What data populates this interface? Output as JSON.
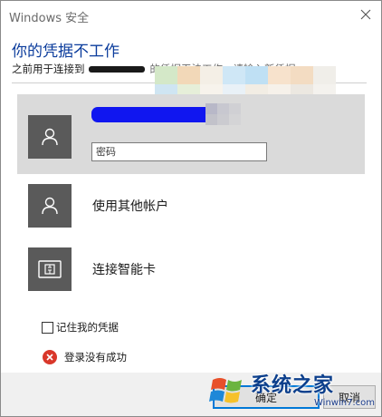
{
  "window": {
    "title": "Windows 安全"
  },
  "header": {
    "heading": "你的凭据不工作",
    "subheading_prefix": "之前用于连接到",
    "subheading_suffix": "的凭据无法工作。请输入新凭据"
  },
  "account": {
    "password_placeholder": "密码"
  },
  "options": [
    {
      "label": "使用其他帐户",
      "icon": "user-icon"
    },
    {
      "label": "连接智能卡",
      "icon": "smart-card-icon"
    }
  ],
  "remember": {
    "label": "记住我的凭据",
    "checked": false
  },
  "error": {
    "message": "登录没有成功"
  },
  "buttons": {
    "ok": "确定",
    "cancel": "取消"
  },
  "watermark": {
    "brand": "系统之家",
    "url": "Winwin7.com"
  },
  "colors": {
    "heading": "#0b3c9c",
    "selected_bg": "#dadada",
    "avatar_bg": "#5a5a5a",
    "ok_border": "#0078d7",
    "error": "#d9372a"
  }
}
